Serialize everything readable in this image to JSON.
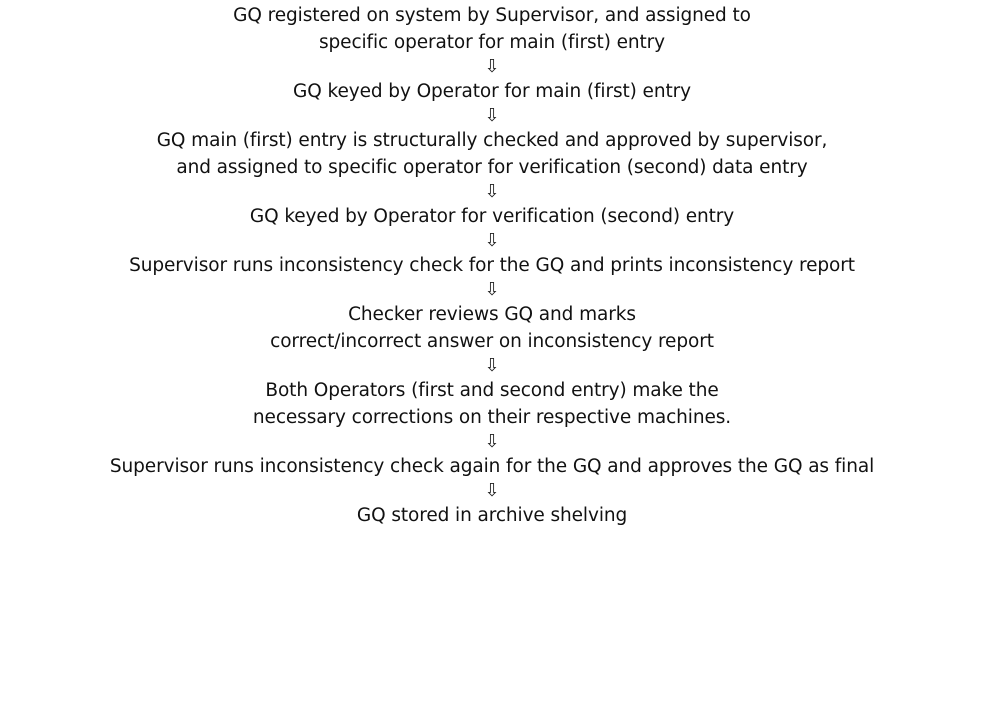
{
  "flowchart": {
    "arrow_glyph": "⇩",
    "steps": [
      {
        "lines": [
          "GQ registered on system by Supervisor, and assigned to",
          "specific operator for main (first) entry"
        ]
      },
      {
        "lines": [
          "GQ keyed by Operator for main (first) entry"
        ]
      },
      {
        "lines": [
          "GQ main (first) entry is structurally checked and approved by supervisor,",
          "and assigned to specific operator for verification (second) data entry"
        ]
      },
      {
        "lines": [
          "GQ keyed by Operator for verification (second) entry"
        ]
      },
      {
        "lines": [
          "Supervisor runs inconsistency check for the GQ and prints inconsistency report"
        ]
      },
      {
        "lines": [
          "Checker reviews GQ and marks",
          "correct/incorrect answer on inconsistency report"
        ]
      },
      {
        "lines": [
          "Both Operators (first and second entry) make the",
          "necessary corrections on their respective machines."
        ]
      },
      {
        "lines": [
          "Supervisor runs inconsistency check again for the GQ and approves the GQ as final"
        ]
      },
      {
        "lines": [
          "GQ stored in archive shelving"
        ]
      }
    ]
  }
}
